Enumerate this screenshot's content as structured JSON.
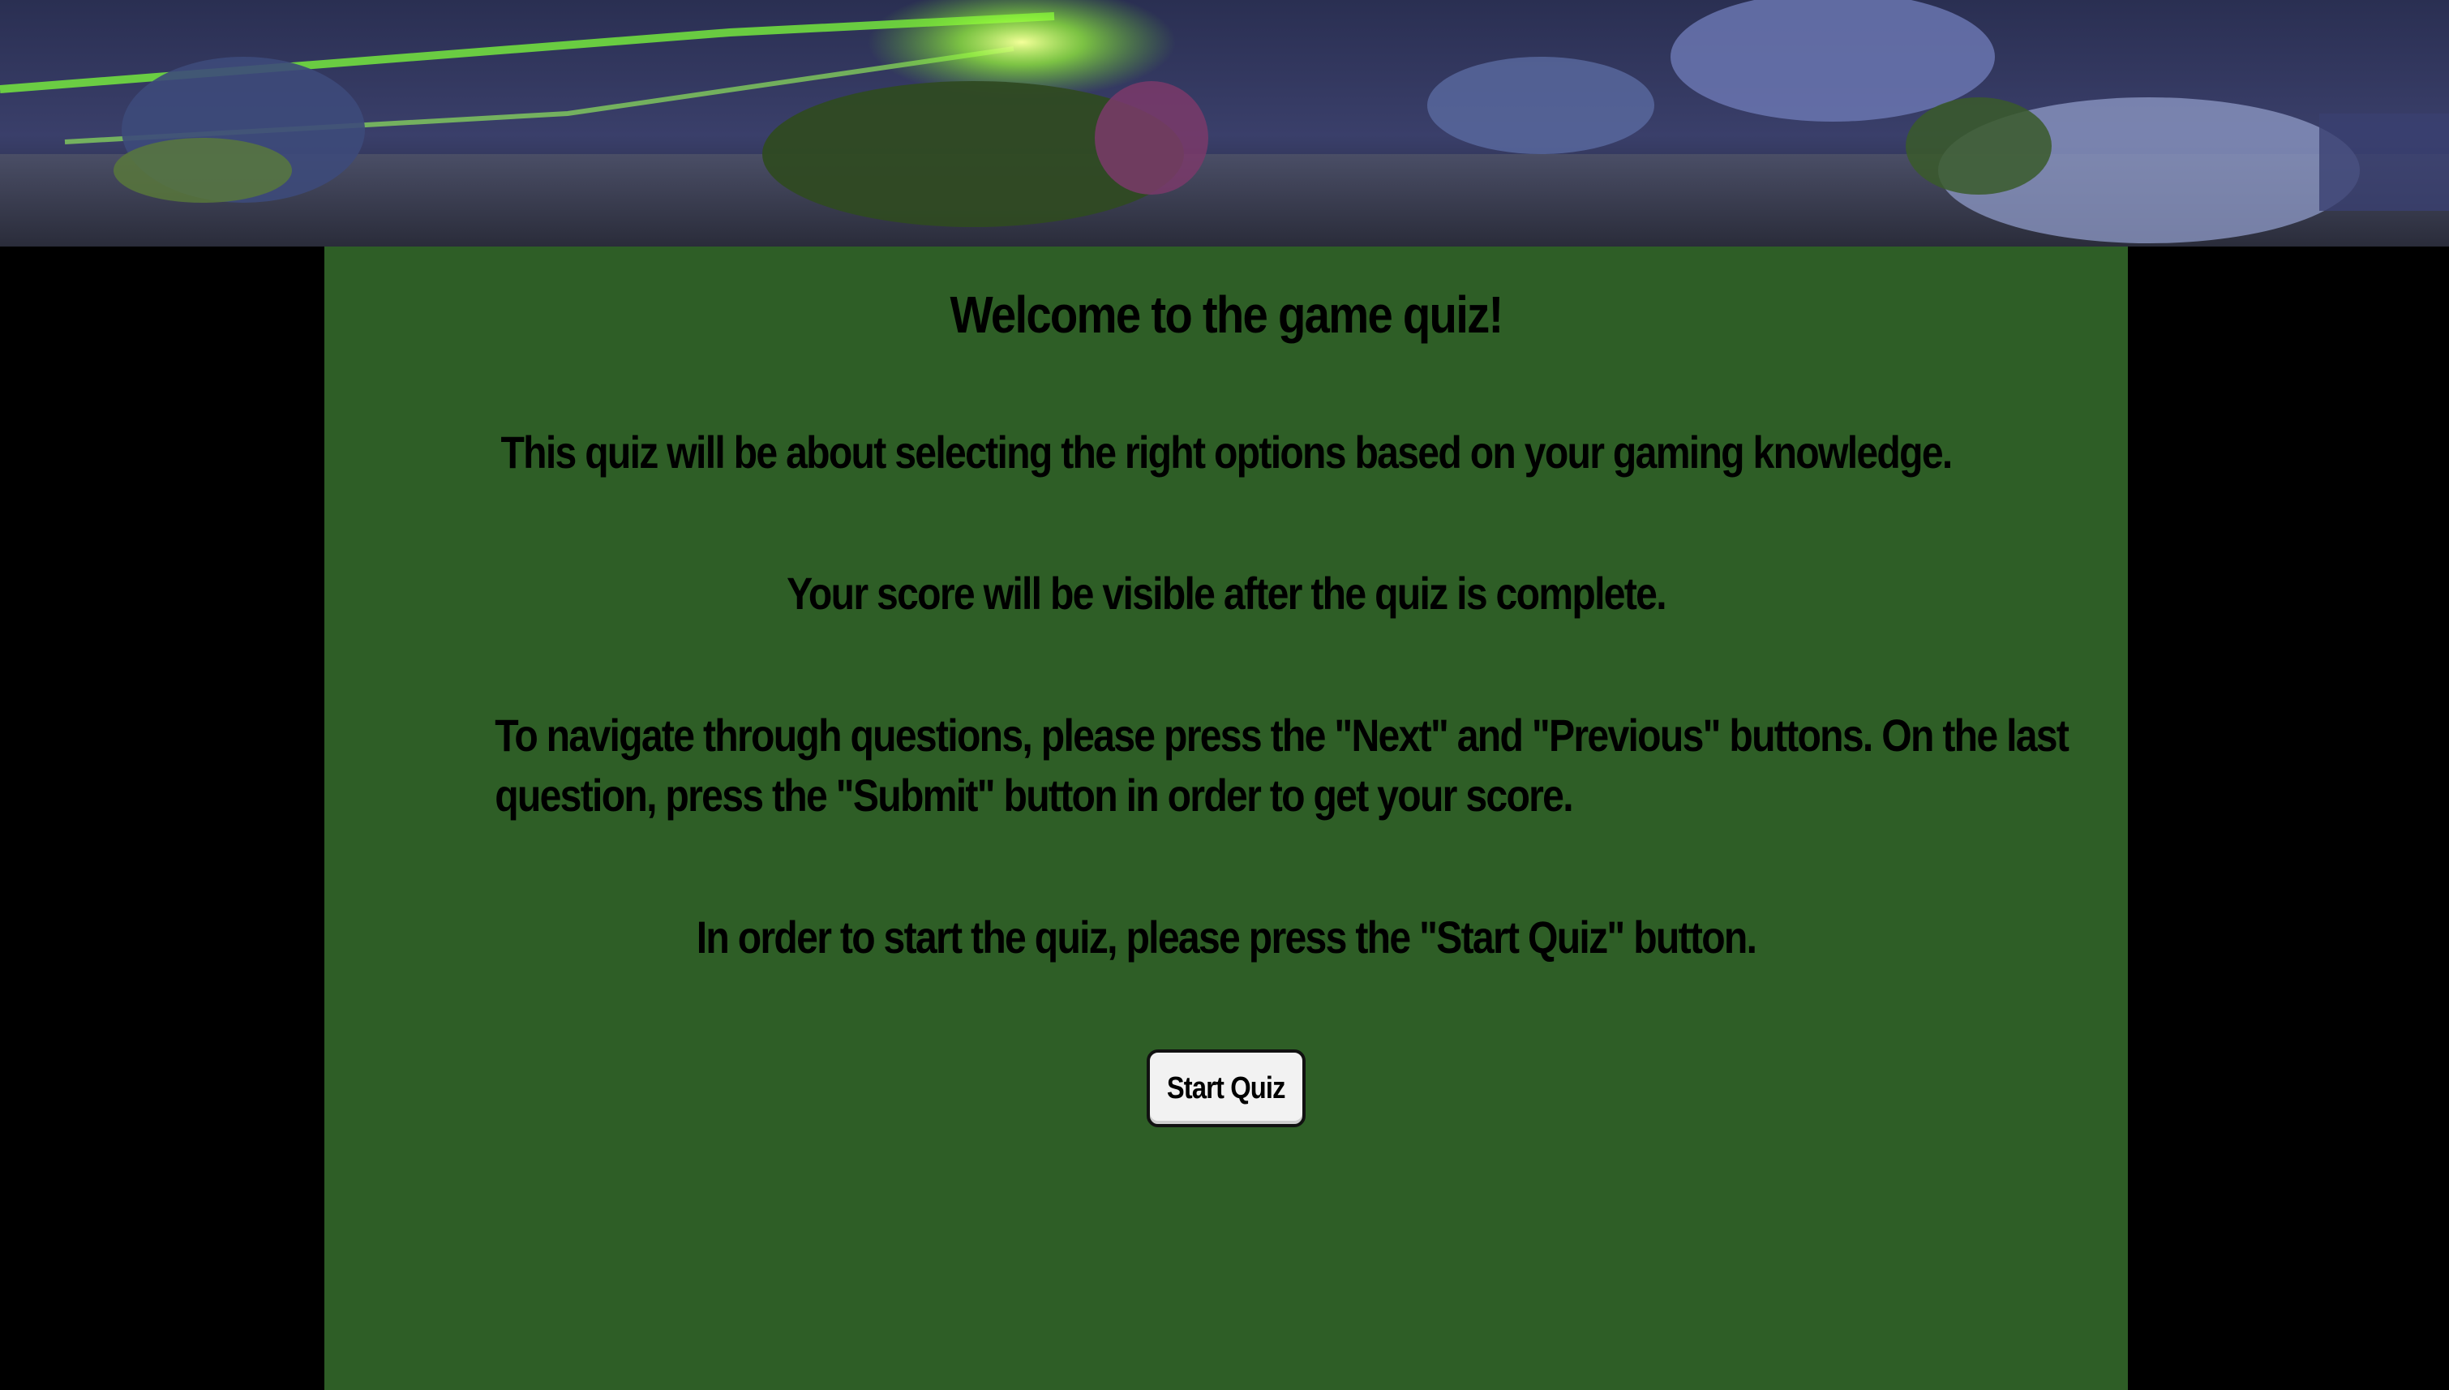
{
  "banner": {
    "image": "game-battle-scene-banner"
  },
  "intro": {
    "title": "Welcome to the game quiz!",
    "about": "This quiz will be about selecting the right options based on your gaming knowledge.",
    "score_note": "Your score will be visible after the quiz is complete.",
    "navigation": "To navigate through questions, please press the \"Next\" and \"Previous\" buttons. On the last question, press the \"Submit\" button in order to get your score.",
    "start_note": "In order to start the quiz, please press the \"Start Quiz\" button."
  },
  "start_button": {
    "label": "Start Quiz"
  },
  "colors": {
    "page_background": "#000000",
    "content_background": "#2e5e26",
    "text": "#000000",
    "button_background": "#f2f2f2"
  }
}
